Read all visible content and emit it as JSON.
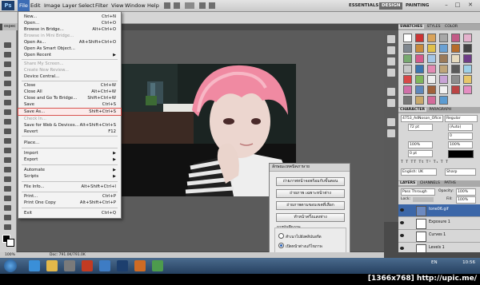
{
  "menubar": {
    "logo": "Ps",
    "menus": [
      "File",
      "Edit",
      "Image",
      "Layer",
      "Select",
      "Filter",
      "View",
      "Window",
      "Help"
    ],
    "workspaces": [
      "ESSENTIALS",
      "DESIGN",
      "PAINTING"
    ],
    "window_controls": [
      "–",
      "□",
      "✕"
    ]
  },
  "doc_tab": "ospec",
  "file_menu": {
    "items": [
      {
        "label": "New...",
        "shortcut": "Ctrl+N"
      },
      {
        "label": "Open...",
        "shortcut": "Ctrl+O"
      },
      {
        "label": "Browse in Bridge...",
        "shortcut": "Alt+Ctrl+O"
      },
      {
        "label": "Browse in Mini Bridge...",
        "shortcut": ""
      },
      {
        "label": "Open As...",
        "shortcut": "Alt+Shift+Ctrl+O"
      },
      {
        "label": "Open As Smart Object...",
        "shortcut": ""
      },
      {
        "label": "Open Recent",
        "shortcut": ""
      },
      {
        "label": "Share My Screen...",
        "shortcut": ""
      },
      {
        "label": "Create New Review...",
        "shortcut": ""
      },
      {
        "label": "Device Central...",
        "shortcut": ""
      },
      {
        "label": "Close",
        "shortcut": "Ctrl+W"
      },
      {
        "label": "Close All",
        "shortcut": "Alt+Ctrl+W"
      },
      {
        "label": "Close and Go To Bridge...",
        "shortcut": "Shift+Ctrl+W"
      },
      {
        "label": "Save",
        "shortcut": "Ctrl+S"
      },
      {
        "label": "Save As...",
        "shortcut": "Shift+Ctrl+S"
      },
      {
        "label": "Check In...",
        "shortcut": ""
      },
      {
        "label": "Save for Web & Devices...",
        "shortcut": "Alt+Shift+Ctrl+S"
      },
      {
        "label": "Revert",
        "shortcut": "F12"
      },
      {
        "label": "Place...",
        "shortcut": ""
      },
      {
        "label": "Import",
        "shortcut": ""
      },
      {
        "label": "Export",
        "shortcut": ""
      },
      {
        "label": "Automate",
        "shortcut": ""
      },
      {
        "label": "Scripts",
        "shortcut": ""
      },
      {
        "label": "File Info...",
        "shortcut": "Alt+Shift+Ctrl+I"
      },
      {
        "label": "Print...",
        "shortcut": "Ctrl+P"
      },
      {
        "label": "Print One Copy",
        "shortcut": "Alt+Shift+Ctrl+P"
      },
      {
        "label": "Exit",
        "shortcut": "Ctrl+Q"
      }
    ]
  },
  "dialog": {
    "title": "ลักษณะเทคนิคภาษาย",
    "buttons": [
      "ถ่ายภาพหน้าจอพร้อมกับขั้นตอน",
      "ถ่ายภาพ เฉพาะหน้าต่าง",
      "ถ่ายภาพตามขอบเขตที่เลือก",
      "ทำหน้าครึ่งแสงท่าง"
    ],
    "group_label": "การบันทึกภาพ",
    "options": [
      "สำเนาไปยังคลิปบอร์ด",
      "เปิดหน้าต่างแก้ไขภาพ"
    ]
  },
  "panels": {
    "swatch_tabs": [
      "SWATCHES",
      "STYLES",
      "COLOR"
    ],
    "char_tabs": [
      "CHARACTER",
      "PARAGRAPH"
    ],
    "font_family": "4753_AdNoson_Ofice",
    "font_style": "Regular",
    "font_size": "72 pt",
    "leading": "(Auto)",
    "tracking": "0",
    "scale_v": "100%",
    "scale_h": "100%",
    "baseline": "0 pt",
    "language": "English: UK",
    "aa": "Sharp",
    "layer_tabs": [
      "LAYERS",
      "CHANNELS",
      "PATHS"
    ],
    "blend_mode": "Pass Through",
    "opacity_label": "Opacity:",
    "opacity": "100%",
    "lock_label": "Lock:",
    "fill_label": "Fill:",
    "fill": "100%",
    "layers": [
      "tone06.gif",
      "Exposure 1",
      "Curves 1",
      "Levels 1"
    ]
  },
  "status": {
    "zoom": "100%",
    "doc": "Doc: 791.0K/791.0K"
  },
  "taskbar": {
    "lang": "EN",
    "time": "10:56"
  },
  "footer": {
    "watermark": "[1366x768] http://upic.me/"
  }
}
